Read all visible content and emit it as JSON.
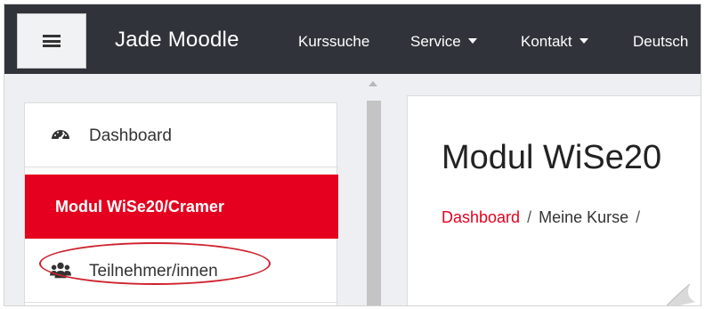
{
  "navbar": {
    "brand": "Jade Moodle",
    "items": [
      {
        "label": "Kurssuche",
        "has_caret": false
      },
      {
        "label": "Service",
        "has_caret": true
      },
      {
        "label": "Kontakt",
        "has_caret": true
      },
      {
        "label": "Deutsch",
        "has_caret": false
      }
    ],
    "menu_icon": "hamburger-icon",
    "background": "#303339"
  },
  "sidebar": {
    "items": [
      {
        "label": "Dashboard",
        "icon": "tachometer-icon",
        "active": false
      },
      {
        "label": "Modul WiSe20/Cramer",
        "icon": null,
        "active": true
      },
      {
        "label": "Teilnehmer/innen",
        "icon": "users-icon",
        "active": false,
        "highlighted": true
      }
    ],
    "active_color": "#e4001e"
  },
  "main": {
    "title": "Modul WiSe20",
    "breadcrumb": [
      {
        "label": "Dashboard",
        "is_link": true
      },
      {
        "label": "Meine Kurse",
        "is_link": false
      }
    ],
    "breadcrumb_separator": "/"
  },
  "colors": {
    "accent": "#e4001e",
    "highlight_oval": "#d0212e"
  }
}
